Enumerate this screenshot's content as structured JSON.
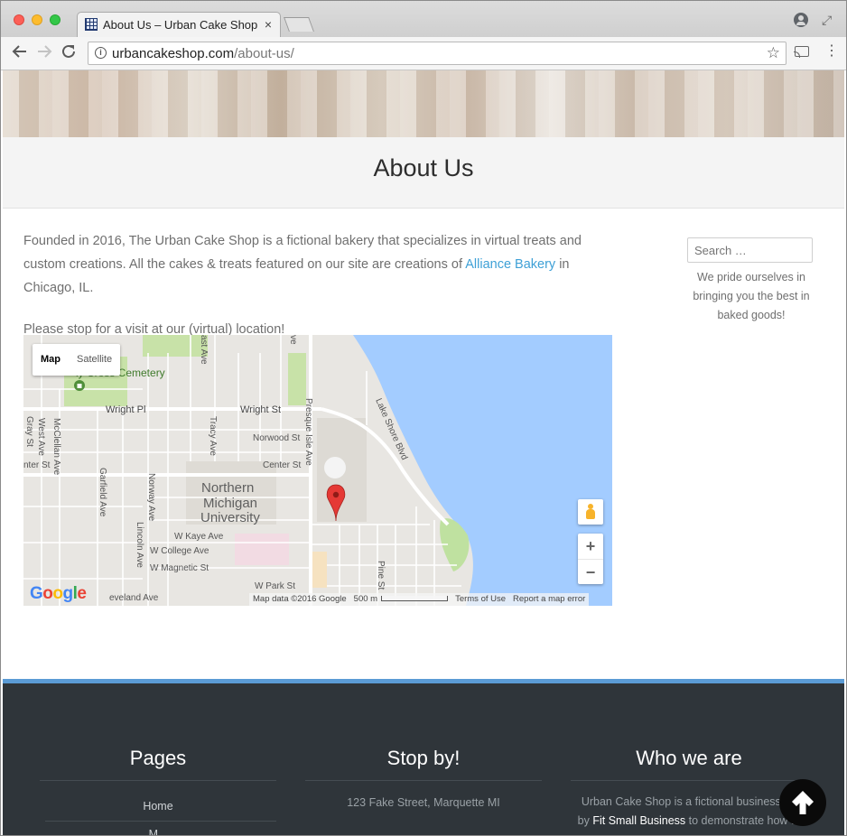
{
  "browser": {
    "tab_title": "About Us – Urban Cake Shop",
    "tab_close": "×",
    "url_host": "urbancakeshop.com",
    "url_path": "/about-us/"
  },
  "page": {
    "title": "About Us",
    "intro_before": "Founded in 2016, The Urban Cake Shop is a fictional bakery that specializes in virtual treats and custom creations. All the cakes & treats featured on our site are creations of ",
    "intro_link": "Alliance Bakery",
    "intro_after": " in Chicago, IL.",
    "visit_text": "Please stop for a visit at our (virtual) location!"
  },
  "sidebar": {
    "search_placeholder": "Search …",
    "tagline": "We pride ourselves in bringing you the best in baked goods!"
  },
  "map": {
    "type_map": "Map",
    "type_satellite": "Satellite",
    "zoom_in": "+",
    "zoom_out": "−",
    "attribution": "Map data ©2016 Google",
    "scale": "500 m",
    "terms": "Terms of Use",
    "report": "Report a map error",
    "labels": {
      "cemetery": "ly Cross Cemetery",
      "wright_pl": "Wright Pl",
      "wright_st": "Wright St",
      "norwood": "Norwood St",
      "center": "Center St",
      "presque": "Presque Isle Ave",
      "lakeshore": "Lake Shore Blvd",
      "nmu1": "Northern",
      "nmu2": "Michigan",
      "nmu3": "University",
      "kaye": "W Kaye Ave",
      "college": "W College Ave",
      "magnetic": "W Magnetic St",
      "park": "W Park St",
      "pine": "Pine St",
      "cleveland": "eveland Ave",
      "gray": "Gray St",
      "west": "West Ave",
      "mcclellan": "McClellan Ave",
      "garfield": "Garfield Ave",
      "norway": "Norway Ave",
      "lincoln": "Lincoln Ave",
      "tracy": "Tracy Ave",
      "east_ave": "ast Ave",
      "ave_top": "ve",
      "center_w": "nter St"
    }
  },
  "footer": {
    "pages_title": "Pages",
    "pages_items": [
      "Home",
      "M..."
    ],
    "stop_title": "Stop by!",
    "address": "123 Fake Street, Marquette MI",
    "who_title": "Who we are",
    "who_line1": "Urban Cake Shop is a fictional business, cr",
    "who_line2_before": "by ",
    "who_link": "Fit Small Business",
    "who_line2_after": " to demonstrate how to"
  },
  "colors": {
    "link": "#3ea0d6",
    "footer_bg": "#2f353a",
    "footer_accent": "#5b9bd5",
    "water": "#a3ccff",
    "marker": "#e53935"
  }
}
